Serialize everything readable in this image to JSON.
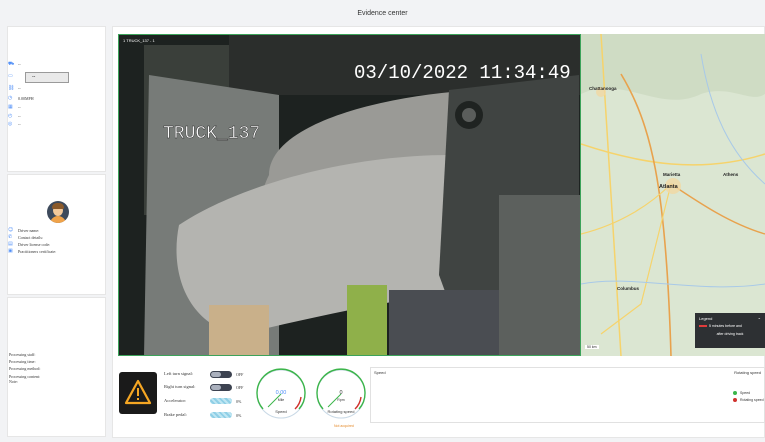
{
  "title": "Evidence center",
  "vehicle": {
    "rows": [
      {
        "icon": "truck-icon",
        "value": "--"
      },
      {
        "icon": "plate-icon",
        "value": "--"
      },
      {
        "icon": "link-icon",
        "value": "--"
      },
      {
        "icon": "speed-icon",
        "value": "0.00MPH"
      },
      {
        "icon": "calendar-icon",
        "value": "--"
      },
      {
        "icon": "clock-icon",
        "value": "--"
      },
      {
        "icon": "location-icon",
        "value": "--"
      }
    ]
  },
  "driver": {
    "name_label": "Driver name:",
    "contact_label": "Contact details:",
    "license_label": "Driver license code:",
    "cert_label": "Practitioners certificate:"
  },
  "processing": {
    "staff": "Processing staff:",
    "time": "Processing time:",
    "method": "Processing method:",
    "content": "Processing content:",
    "note": "Note:"
  },
  "video": {
    "channel_label": "1 TRUCK_137 - 1",
    "overlay_timestamp": "03/10/2022 11:34:49",
    "overlay_vehicle": "TRUCK_137"
  },
  "map": {
    "cities": [
      "Chattanooga",
      "Marietta",
      "Atlanta",
      "Athens",
      "Columbus"
    ],
    "scale": "50 km",
    "legend_title": "Legend",
    "legend_line1": "5 minutes before and",
    "legend_line2": "after driving track"
  },
  "signals": {
    "left_turn_label": "Left turn signal:",
    "left_turn_value": "OFF",
    "right_turn_label": "Right turn signal:",
    "right_turn_value": "OFF",
    "accelerator_label": "Accelerator:",
    "accelerator_value": "0%",
    "brake_label": "Brake pedal:",
    "brake_value": "0%"
  },
  "gauges": {
    "speed_value": "0.00",
    "speed_unit": "Mile",
    "speed_label": "Speed",
    "rotating_value": "0",
    "rotating_unit": "Rpm",
    "rotating_label": "Rotating speed",
    "not_acquired": "Not acquired"
  },
  "chart_data": {
    "type": "line",
    "left_title": "Speed",
    "right_title": "Rotating speed",
    "series": [
      {
        "name": "Speed",
        "values": []
      },
      {
        "name": "Rotating speed",
        "values": []
      }
    ]
  },
  "colors": {
    "accent": "#4f8ef7",
    "speed_series": "#3bb54a",
    "rotating_series": "#d0312d",
    "warning": "#f5a623"
  }
}
